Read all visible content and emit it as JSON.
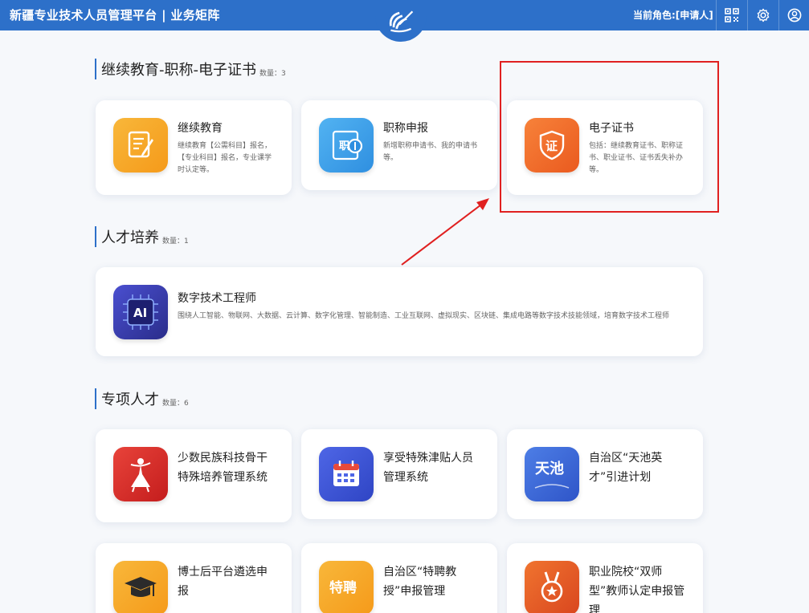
{
  "header": {
    "title": "新疆专业技术人员管理平台 | 业务矩阵",
    "role": "当前角色:[申请人]",
    "icons": [
      "qrcode-icon",
      "gear-icon",
      "user-icon"
    ]
  },
  "sections": [
    {
      "title": "继续教育-职称-电子证书",
      "count": "数量：3",
      "cards": [
        {
          "name": "继续教育",
          "desc": "继续教育【公需科目】报名，【专业科目】报名，专业课学时认定等。",
          "icon": "edit-document-icon",
          "color": "#f5a623"
        },
        {
          "name": "职称申报",
          "desc": "新增职称申请书、我的申请书等。",
          "icon": "title-document-icon",
          "color": "#3a9de8"
        },
        {
          "name": "电子证书",
          "desc": "包括：继续教育证书、职称证书、职业证书、证书丢失补办等。",
          "icon": "shield-cert-icon",
          "color": "#f06a2a"
        }
      ]
    },
    {
      "title": "人才培养",
      "count": "数量：1",
      "cards": [
        {
          "name": "数字技术工程师",
          "desc": "围绕人工智能、物联网、大数据、云计算、数字化管理、智能制造、工业互联网、虚拟现实、区块链、集成电路等数字技术技能领域，培育数字技术工程师",
          "icon": "ai-chip-icon",
          "icon_text": "AI",
          "color": "#3a3fb0"
        }
      ]
    },
    {
      "title": "专项人才",
      "count": "数量：6",
      "cards": [
        {
          "name": "少数民族科技骨干特殊培养管理系统",
          "icon": "dancer-icon",
          "color": "#d92b2b"
        },
        {
          "name": "享受特殊津贴人员管理系统",
          "icon": "calendar-icon",
          "color": "#3b55d8"
        },
        {
          "name": "自治区“天池英才”引进计划",
          "icon": "tianchi-icon",
          "icon_text": "天池",
          "color": "#3a63d8"
        },
        {
          "name": "博士后平台遴选申报",
          "icon": "graduation-cap-icon",
          "color": "#f5a623"
        },
        {
          "name": "自治区“特聘教授”申报管理",
          "icon": "tepin-icon",
          "icon_text": "特聘",
          "color": "#f5a623"
        },
        {
          "name": "职业院校“双师型”教师认定申报管理",
          "icon": "medal-icon",
          "color": "#e2582a"
        }
      ]
    }
  ]
}
